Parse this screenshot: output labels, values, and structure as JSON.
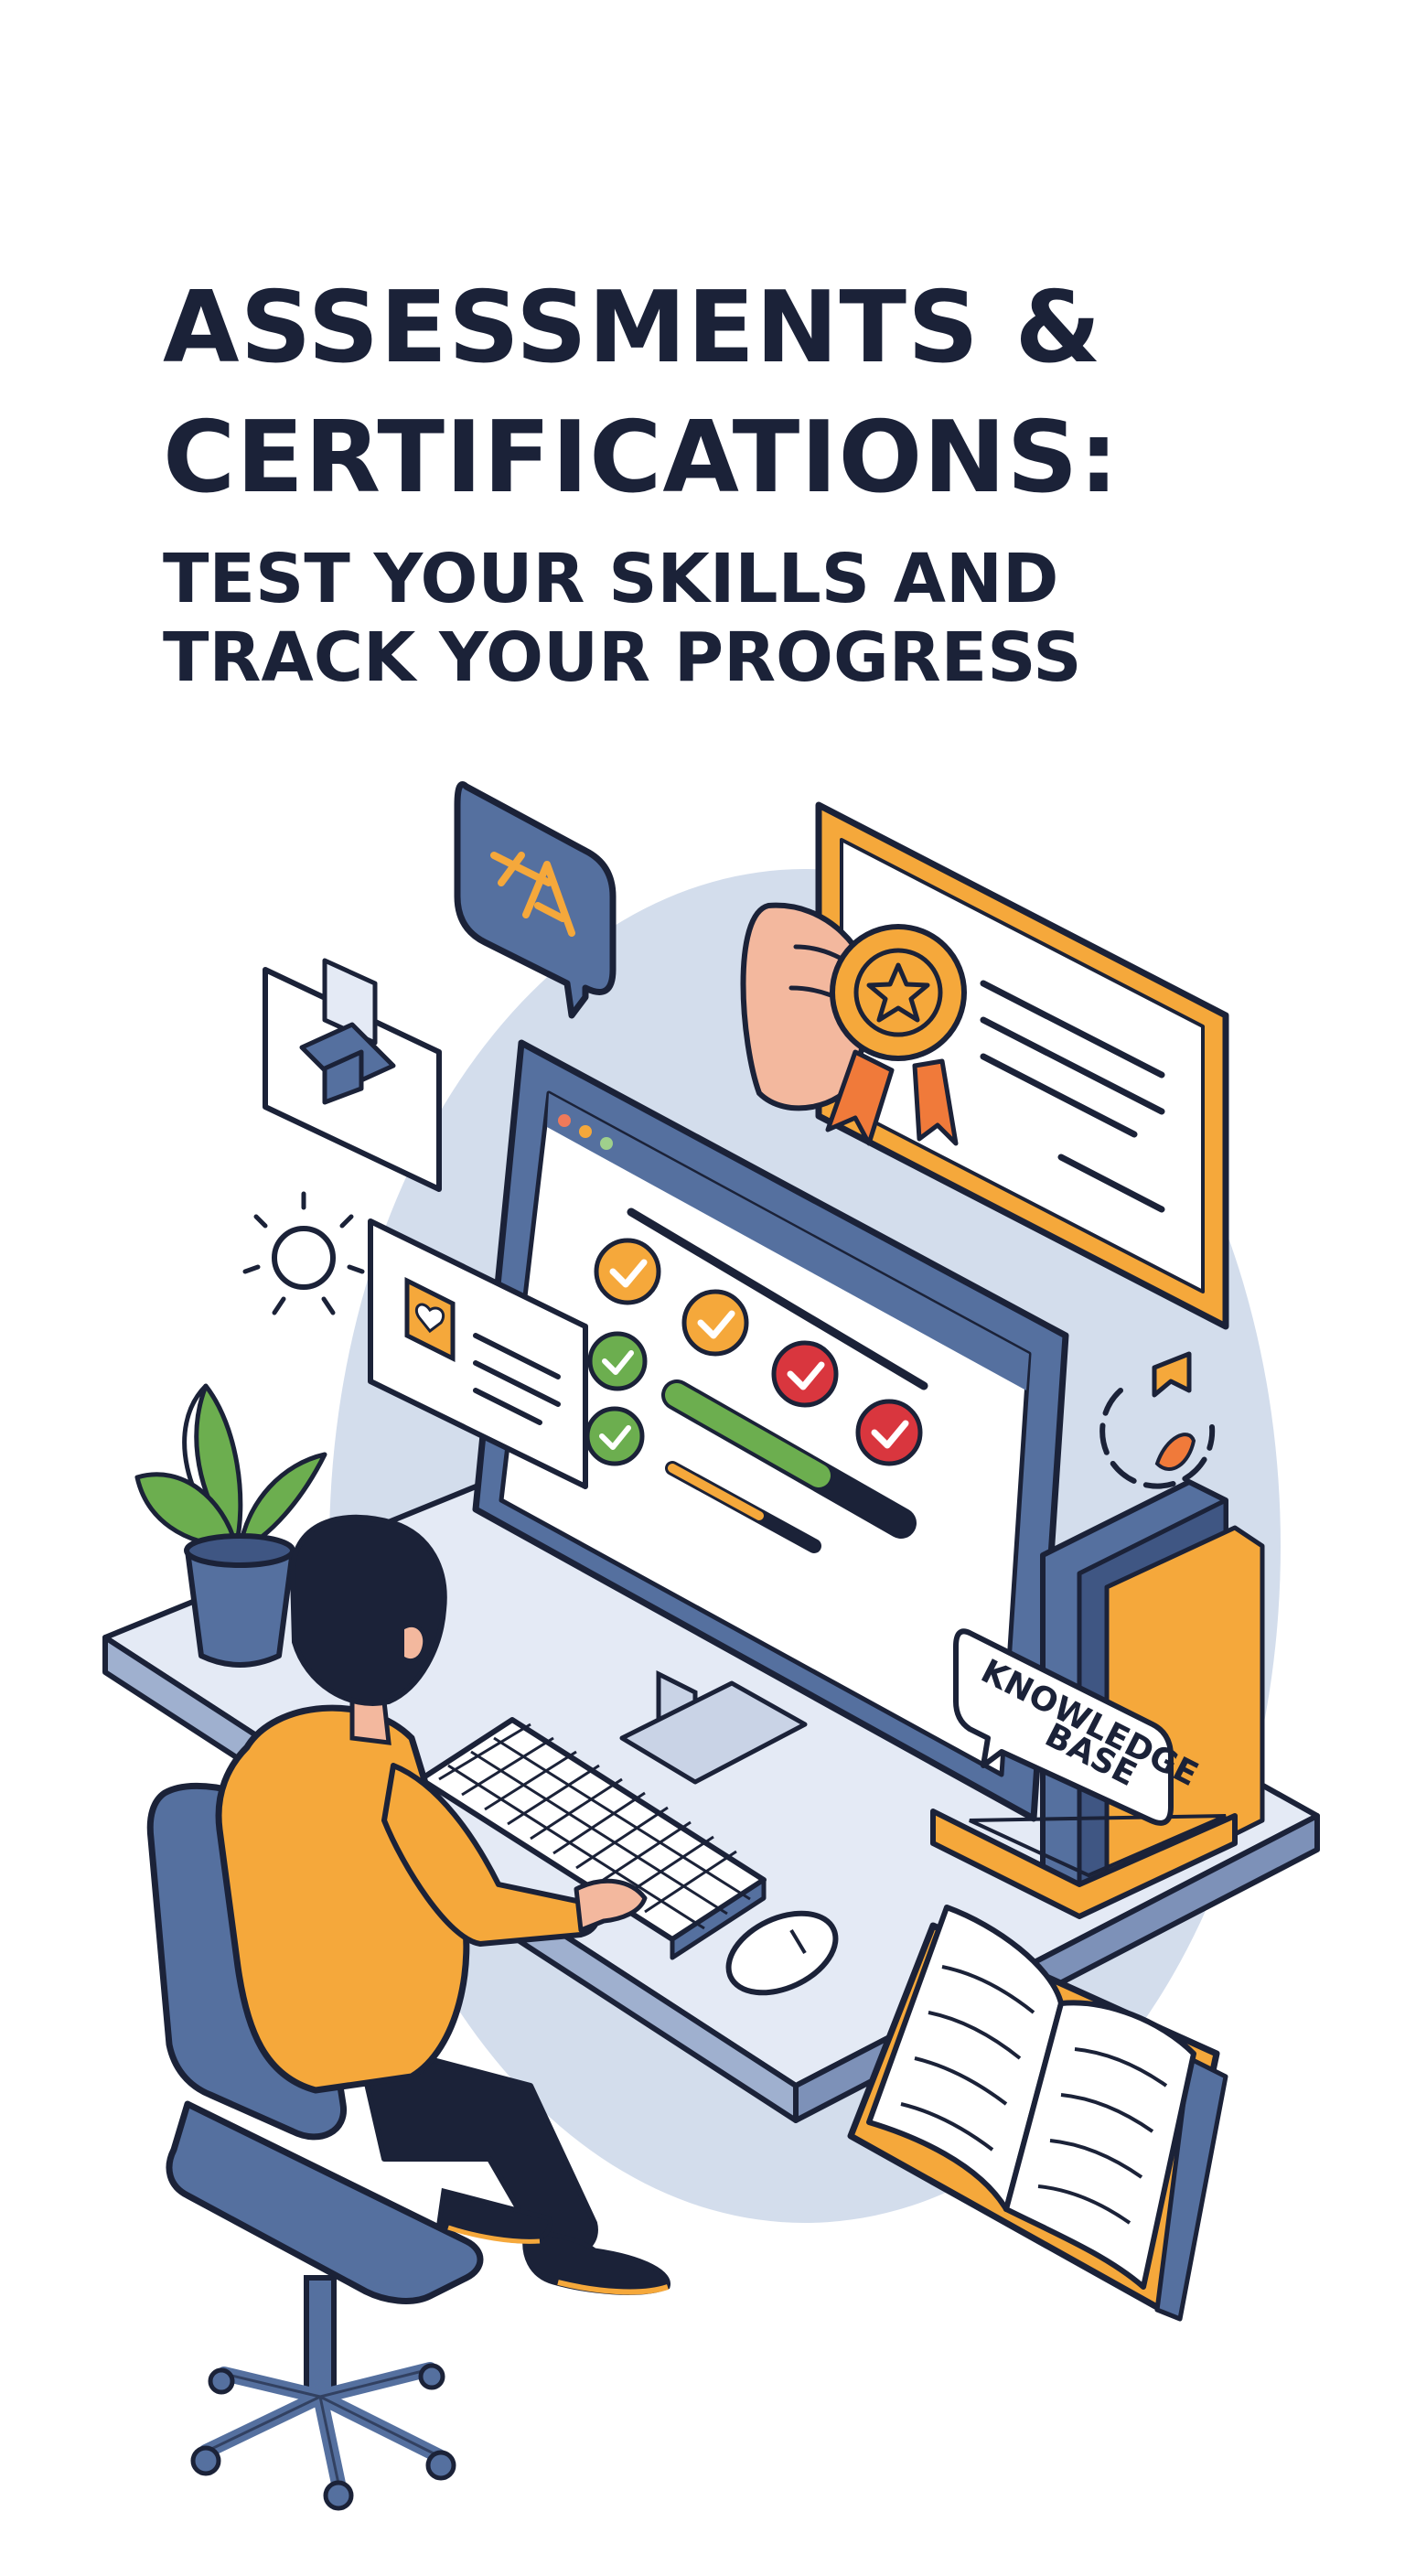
{
  "heading": {
    "title_line1": "ASSESSMENTS &",
    "title_line2": "CERTIFICATIONS:",
    "subtitle_line1": "TEST YOUR SKILLS AND",
    "subtitle_line2": "TRACK YOUR PROGRESS"
  },
  "illustration": {
    "book_label_line1": "KNOWLEDGE",
    "book_label_line2": "BASE",
    "colors": {
      "navy": "#1b2238",
      "blue": "#55709f",
      "light_blue": "#d3ddec",
      "orange": "#f5a83b",
      "green": "#6cae4f",
      "red": "#d9363e",
      "skin": "#f3b89e"
    },
    "icons": [
      "translate-bubble-icon",
      "graduation-cap-icon",
      "certificate-icon",
      "award-ribbon-icon",
      "lightbulb-icon",
      "heart-card-icon",
      "target-icon",
      "potted-plant-icon",
      "open-book-icon"
    ]
  }
}
